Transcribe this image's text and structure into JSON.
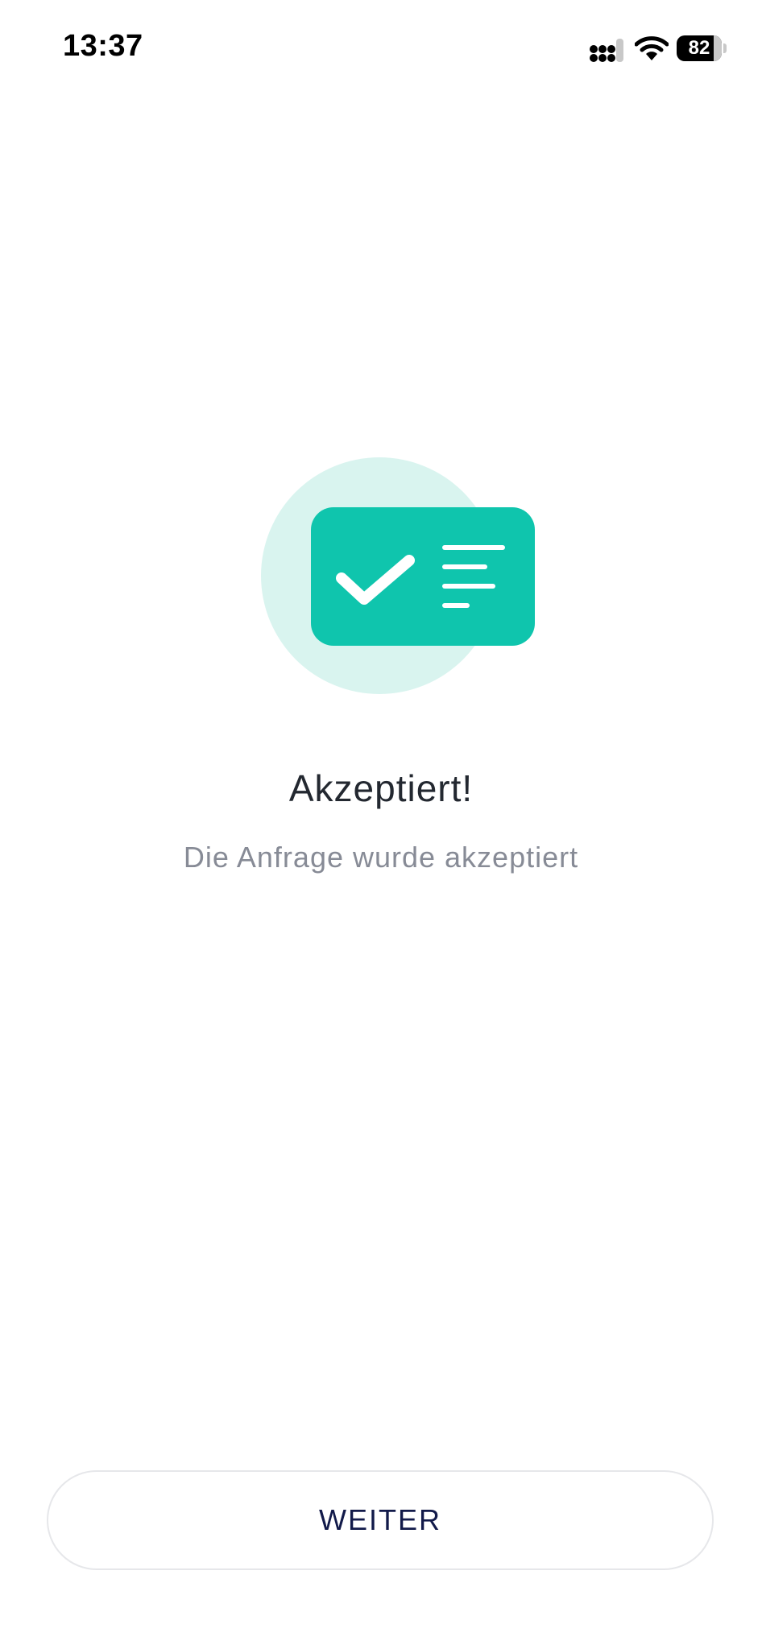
{
  "status_bar": {
    "time": "13:37",
    "battery_level": "82",
    "battery_fraction": 0.82,
    "icons": [
      "signal-icon",
      "wifi-icon",
      "battery-icon"
    ]
  },
  "illustration": {
    "icon": "accepted-document-icon",
    "colors": {
      "circle": "#d9f4ef",
      "card": "#0fc5ad",
      "marks": "#ffffff"
    }
  },
  "message": {
    "title": "Akzeptiert!",
    "subtitle": "Die Anfrage wurde akzeptiert"
  },
  "actions": {
    "continue_label": "WEITER"
  },
  "colors": {
    "accent": "#0fc5ad",
    "title_text": "#232830",
    "subtitle_text": "#878b96",
    "button_text": "#121a4a",
    "button_border": "#e6e7ea"
  }
}
